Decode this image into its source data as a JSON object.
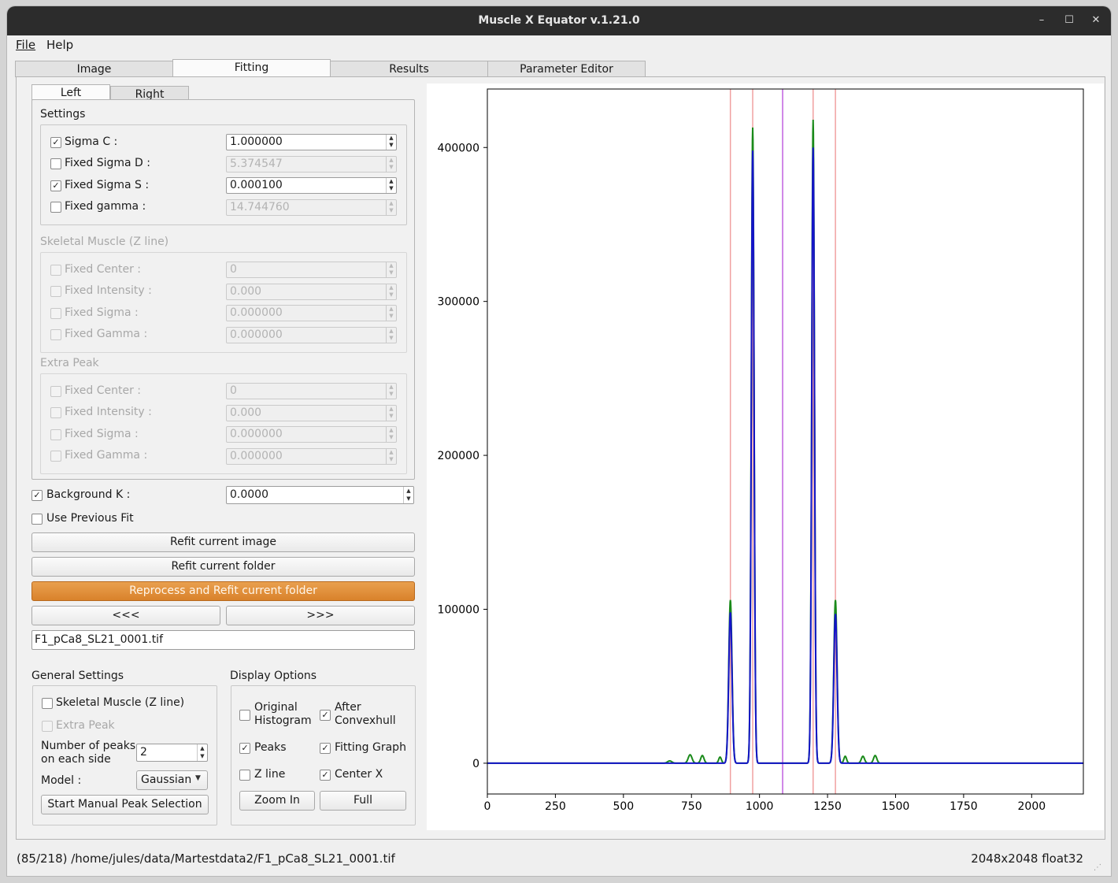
{
  "window": {
    "title": "Muscle X Equator v.1.21.0",
    "minimize": "–",
    "maximize": "☐",
    "close": "✕"
  },
  "menu": {
    "file": "File",
    "help": "Help"
  },
  "tabs": {
    "image": "Image",
    "fitting": "Fitting",
    "results": "Results",
    "parameter_editor": "Parameter Editor",
    "active": "Fitting"
  },
  "side_tabs": {
    "left": "Left",
    "right": "Right",
    "active": "Left"
  },
  "settings": {
    "title": "Settings",
    "sigma_c": {
      "label": "Sigma C :",
      "checked": true,
      "value": "1.000000"
    },
    "fixed_sigma_d": {
      "label": "Fixed Sigma D :",
      "checked": false,
      "value": "5.374547"
    },
    "fixed_sigma_s": {
      "label": "Fixed Sigma S :",
      "checked": true,
      "value": "0.000100"
    },
    "fixed_gamma": {
      "label": "Fixed gamma :",
      "checked": false,
      "value": "14.744760"
    }
  },
  "skeletal": {
    "title": "Skeletal Muscle (Z line)",
    "fixed_center": {
      "label": "Fixed Center :",
      "value": "0"
    },
    "fixed_intensity": {
      "label": "Fixed Intensity :",
      "value": "0.000"
    },
    "fixed_sigma": {
      "label": "Fixed Sigma :",
      "value": "0.000000"
    },
    "fixed_gamma": {
      "label": "Fixed Gamma :",
      "value": "0.000000"
    }
  },
  "extra_peak": {
    "title": "Extra Peak",
    "fixed_center": {
      "label": "Fixed Center :",
      "value": "0"
    },
    "fixed_intensity": {
      "label": "Fixed Intensity :",
      "value": "0.000"
    },
    "fixed_sigma": {
      "label": "Fixed Sigma :",
      "value": "0.000000"
    },
    "fixed_gamma": {
      "label": "Fixed Gamma :",
      "value": "0.000000"
    }
  },
  "background_k": {
    "label": "Background K :",
    "checked": true,
    "value": "0.0000"
  },
  "use_previous_fit": {
    "label": "Use Previous Fit",
    "checked": false
  },
  "buttons": {
    "refit_image": "Refit current image",
    "refit_folder": "Refit current folder",
    "reprocess_folder": "Reprocess and Refit current folder",
    "prev": "<<<",
    "next": ">>>"
  },
  "filename": "F1_pCa8_SL21_0001.tif",
  "general": {
    "title": "General Settings",
    "skeletal_muscle": {
      "label": "Skeletal Muscle (Z line)",
      "checked": false
    },
    "extra_peak": {
      "label": "Extra Peak",
      "checked": false
    },
    "num_peaks_label1": "Number of peaks",
    "num_peaks_label2": "on each side",
    "num_peaks": "2",
    "model_label": "Model :",
    "model": "Gaussian",
    "manual_peak": "Start Manual Peak Selection"
  },
  "display": {
    "title": "Display Options",
    "original_histogram1": "Original",
    "original_histogram2": "Histogram",
    "original_histogram_checked": false,
    "after_convexhull1": "After",
    "after_convexhull2": "Convexhull",
    "after_convexhull_checked": true,
    "peaks": "Peaks",
    "peaks_checked": true,
    "fitting_graph": "Fitting Graph",
    "fitting_graph_checked": true,
    "z_line": "Z line",
    "z_line_checked": false,
    "center_x": "Center X",
    "center_x_checked": true,
    "zoom_in": "Zoom In",
    "full": "Full"
  },
  "status": {
    "path": "(85/218) /home/jules/data/Martestdata2/F1_pCa8_SL21_0001.tif",
    "image_info": "2048x2048 float32"
  },
  "chart_data": {
    "type": "line",
    "xlim": [
      0,
      2190
    ],
    "ylim": [
      -20000,
      438000
    ],
    "xticks": [
      0,
      250,
      500,
      750,
      1000,
      1250,
      1500,
      1750,
      2000
    ],
    "yticks": [
      0,
      100000,
      200000,
      300000,
      400000
    ],
    "tick_labels_x": [
      "0",
      "250",
      "500",
      "750",
      "1000",
      "1250",
      "1500",
      "1750",
      "2000"
    ],
    "tick_labels_y": [
      "0",
      "100000",
      "300000",
      "200000",
      "400000"
    ],
    "peak_lines": [
      893,
      975,
      1197,
      1279
    ],
    "center_line": 1085,
    "colors": {
      "histogram": "#1a8a1a",
      "fit": "#1414c8",
      "peak_line": "#f0a0a0",
      "center_line": "#c060e0",
      "fit_top": "#2a5a10"
    },
    "series": [
      {
        "role": "histogram",
        "peaks": [
          {
            "x": 893,
            "y": 106000,
            "w": 6
          },
          {
            "x": 975,
            "y": 413000,
            "w": 5
          },
          {
            "x": 1197,
            "y": 418000,
            "w": 5
          },
          {
            "x": 1279,
            "y": 106000,
            "w": 6
          },
          {
            "x": 745,
            "y": 5500,
            "w": 7
          },
          {
            "x": 790,
            "y": 5000,
            "w": 6
          },
          {
            "x": 855,
            "y": 4000,
            "w": 5
          },
          {
            "x": 1315,
            "y": 4500,
            "w": 5
          },
          {
            "x": 1380,
            "y": 4500,
            "w": 6
          },
          {
            "x": 1425,
            "y": 5000,
            "w": 6
          },
          {
            "x": 670,
            "y": 1500,
            "w": 8
          }
        ]
      },
      {
        "role": "fit",
        "peaks": [
          {
            "x": 893,
            "y": 98000,
            "w": 6
          },
          {
            "x": 975,
            "y": 398000,
            "w": 5
          },
          {
            "x": 1197,
            "y": 400000,
            "w": 5
          },
          {
            "x": 1279,
            "y": 97000,
            "w": 6
          }
        ]
      }
    ]
  }
}
